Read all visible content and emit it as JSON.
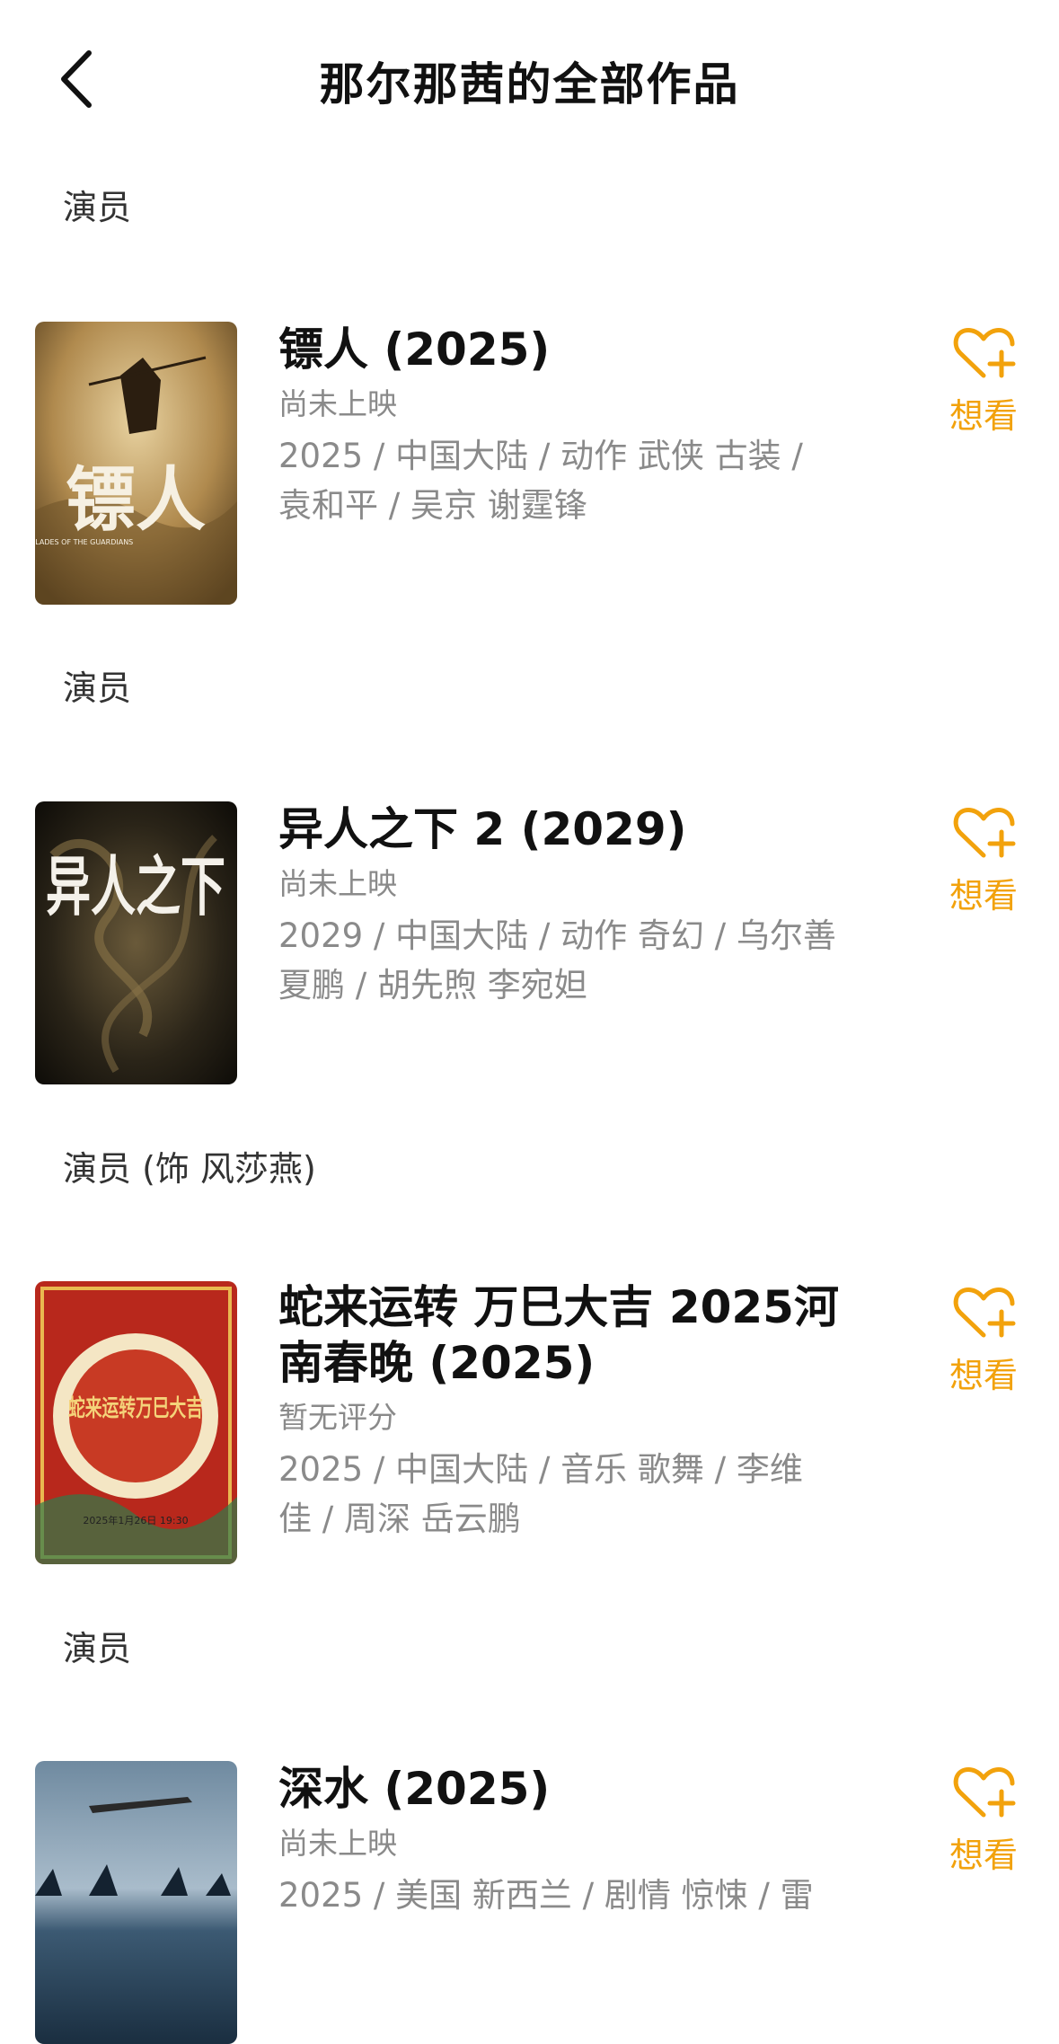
{
  "header": {
    "title": "那尔那茜的全部作品"
  },
  "colors": {
    "accent": "#f2a20c",
    "muted": "#8a8a8a"
  },
  "icons": {
    "back": "chevron-left-icon",
    "want": "heart-plus-icon"
  },
  "works": [
    {
      "role": "演员",
      "title": "镖人 (2025)",
      "status": "尚未上映",
      "meta_line1": "2025 / 中国大陆 / 动作 武侠 古装 /",
      "meta_line2": "袁和平 / 吴京 谢霆锋",
      "want_label": "想看",
      "poster_text": "镖人",
      "poster_subtext": "BLADES OF THE GUARDIANS"
    },
    {
      "role": "演员",
      "title": "异人之下 2 (2029)",
      "status": "尚未上映",
      "meta_line1": "2029 / 中国大陆 / 动作 奇幻 / 乌尔善",
      "meta_line2": "夏鹏 / 胡先煦 李宛妲",
      "want_label": "想看",
      "poster_text": "异人之下"
    },
    {
      "role": "演员 (饰 风莎燕)",
      "title_line1": "蛇来运转 万巳大吉 2025河",
      "title_line2": "南春晚 (2025)",
      "status": "暂无评分",
      "meta_line1": "2025 / 中国大陆 / 音乐 歌舞 / 李维",
      "meta_line2": "佳 / 周深 岳云鹏",
      "want_label": "想看",
      "poster_text": "蛇来运转万巳大吉",
      "poster_subtext": "2025年1月26日 19:30"
    },
    {
      "role": "演员",
      "title": "深水 (2025)",
      "status": "尚未上映",
      "meta_line1": "2025 / 美国 新西兰 / 剧情 惊悚 / 雷",
      "want_label": "想看"
    }
  ]
}
